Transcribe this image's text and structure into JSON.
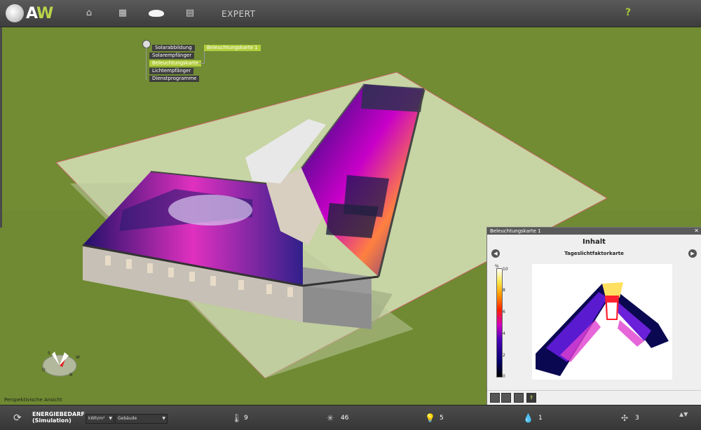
{
  "app": {
    "logo_text_a": "A",
    "logo_text_w": "W"
  },
  "nav": {
    "home_icon": "⌂",
    "grid_icon": "▦",
    "doc_icon": "▤",
    "expert_label": "EXPERT",
    "help_label": "?"
  },
  "tree": {
    "items": [
      "Solarabbildung",
      "Solarempfänger",
      "Beleuchtungskarte",
      "Lichtempfänger",
      "Dienstprogramme"
    ],
    "child": "Beleuchtungskarte 1"
  },
  "panel": {
    "title": "Beleuchtungskarte 1",
    "close": "✕",
    "heading": "Inhalt",
    "map_title": "Tageslichtfaktorkarte",
    "prev": "◀",
    "next": "▶",
    "unit": "%",
    "ticks": [
      "10",
      "8",
      "6",
      "4",
      "2",
      "0"
    ],
    "tool_help": "?"
  },
  "compass": {
    "w": "W",
    "n": "N",
    "o": "O",
    "s": "S"
  },
  "view_label": "Perspektivische Ansicht",
  "bottom": {
    "refresh_icon": "⟳",
    "energy_line1": "ENERGIEBEDARF",
    "energy_line2": "(Simulation)",
    "unit_select": "kWh/m²",
    "scope_select": "Gebäude",
    "stats": [
      {
        "icon": "🌡",
        "value": "9"
      },
      {
        "icon": "✳",
        "value": "46"
      },
      {
        "icon": "💡",
        "value": "5"
      },
      {
        "icon": "💧",
        "value": "1"
      },
      {
        "icon": "✣",
        "value": "3"
      }
    ],
    "scroll": "▲▼"
  },
  "colors": {
    "accent": "#b2cd3c",
    "ground": "#6f8a32",
    "bar": "#3d3d3d"
  }
}
